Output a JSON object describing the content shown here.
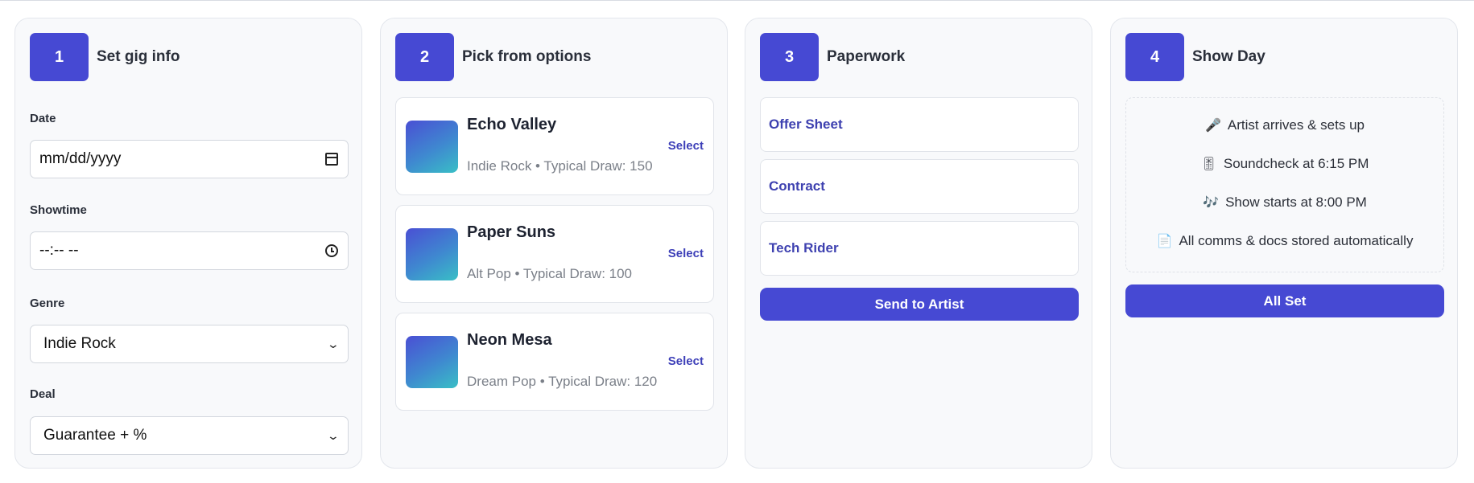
{
  "steps": [
    {
      "number": "1",
      "title": "Set gig info"
    },
    {
      "number": "2",
      "title": "Pick from options"
    },
    {
      "number": "3",
      "title": "Paperwork"
    },
    {
      "number": "4",
      "title": "Show Day"
    }
  ],
  "gig_info": {
    "date_label": "Date",
    "date_placeholder": "mm/dd/yyyy",
    "showtime_label": "Showtime",
    "showtime_placeholder": "--:-- --",
    "genre_label": "Genre",
    "genre_value": "Indie Rock",
    "deal_label": "Deal",
    "deal_value": "Guarantee + %"
  },
  "options": [
    {
      "name": "Echo Valley",
      "meta": "Indie Rock • Typical Draw: 150",
      "action": "Select"
    },
    {
      "name": "Paper Suns",
      "meta": "Alt Pop • Typical Draw: 100",
      "action": "Select"
    },
    {
      "name": "Neon Mesa",
      "meta": "Dream Pop • Typical Draw: 120",
      "action": "Select"
    }
  ],
  "paperwork": {
    "docs": [
      "Offer Sheet",
      "Contract",
      "Tech Rider"
    ],
    "send_button": "Send to Artist"
  },
  "show_day": {
    "items": [
      {
        "icon": "microphone-icon",
        "glyph": "🎤",
        "text": "Artist arrives & sets up"
      },
      {
        "icon": "soundcheck-icon",
        "glyph": "🎚",
        "text": "Soundcheck at 6:15 PM"
      },
      {
        "icon": "music-notes-icon",
        "glyph": "🎶",
        "text": "Show starts at 8:00 PM"
      },
      {
        "icon": "document-icon",
        "glyph": "📄",
        "text": "All comms & docs stored automatically"
      }
    ],
    "button": "All Set"
  },
  "colors": {
    "accent": "#4649d3",
    "link": "#3d3fb8",
    "panel_bg": "#f8f9fb"
  }
}
